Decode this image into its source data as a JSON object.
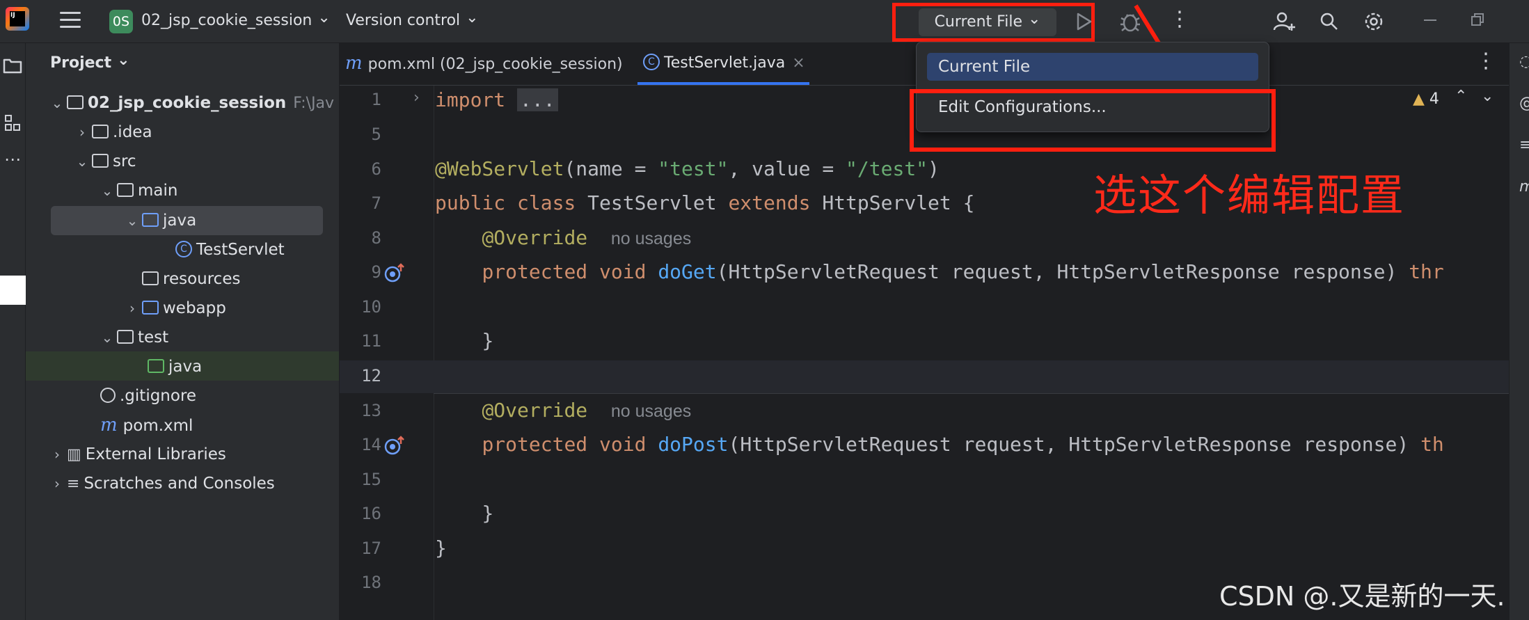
{
  "topbar": {
    "logo_text": "IJ",
    "project_badge": "0S",
    "project_name": "02_jsp_cookie_session",
    "version_control": "Version control",
    "run_config": "Current File"
  },
  "project_panel": {
    "title": "Project",
    "tree": {
      "root": "02_jsp_cookie_session",
      "root_hint": "F:\\Jav",
      "idea": ".idea",
      "src": "src",
      "main": "main",
      "java": "java",
      "testservlet": "TestServlet",
      "resources": "resources",
      "webapp": "webapp",
      "test": "test",
      "test_java": "java",
      "gitignore": ".gitignore",
      "pom": "pom.xml",
      "external_libraries": "External Libraries",
      "scratches": "Scratches and Consoles"
    }
  },
  "tabs": [
    {
      "label": "pom.xml (02_jsp_cookie_session)",
      "active": false
    },
    {
      "label": "TestServlet.java",
      "active": true
    }
  ],
  "editor": {
    "warning_count": "4",
    "line_numbers": [
      "1",
      "5",
      "6",
      "7",
      "8",
      "9",
      "10",
      "11",
      "12",
      "13",
      "14",
      "15",
      "16",
      "17",
      "18"
    ],
    "hints": {
      "no_usages_1": "no usages",
      "no_usages_2": "no usages"
    },
    "code": {
      "l1_kw": "import",
      "l1_fold": "...",
      "l6_ann": "@WebServlet",
      "l6_a": "(name = ",
      "l6_s1": "\"test\"",
      "l6_b": ", value = ",
      "l6_s2": "\"/test\"",
      "l6_c": ")",
      "l7_kw1": "public class",
      "l7_a": " TestServlet ",
      "l7_kw2": "extends",
      "l7_b": " HttpServlet {",
      "l8_ann": "@Override",
      "l9_kw": "protected void",
      "l9_fn": "doGet",
      "l9_a": "(HttpServletRequest request, HttpServletResponse response) ",
      "l9_kw2": "thr",
      "l11": "}",
      "l13_ann": "@Override",
      "l14_kw": "protected void",
      "l14_fn": "doPost",
      "l14_a": "(HttpServletRequest request, HttpServletResponse response) ",
      "l14_kw2": "th",
      "l16": "}",
      "l17": "}"
    }
  },
  "popup": {
    "item_current": "Current File",
    "item_edit": "Edit Configurations..."
  },
  "annotation": "选这个编辑配置",
  "watermark": "CSDN @.又是新的一天.",
  "colors": {
    "highlight": "#ff1f0f",
    "accent": "#3574f0",
    "selection": "#2e436e"
  }
}
